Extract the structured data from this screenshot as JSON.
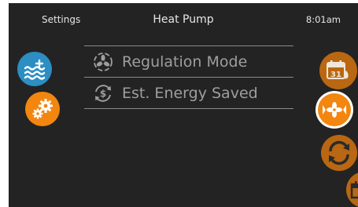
{
  "header": {
    "left_label": "Settings",
    "title": "Heat Pump",
    "time": "8:01am"
  },
  "left_buttons": [
    {
      "icon": "water-heat-icon",
      "color": "#2c8ec3"
    },
    {
      "icon": "gears-icon",
      "color": "#f2860f"
    }
  ],
  "menu": {
    "items": [
      {
        "label": "Regulation Mode",
        "icon": "fan-icon"
      },
      {
        "label": "Est. Energy Saved",
        "icon": "dollar-cycle-icon"
      }
    ]
  },
  "right_buttons": [
    {
      "icon": "calendar-icon",
      "calendar_day": "31",
      "color": "#b96712"
    },
    {
      "icon": "heat-pump-fan-icon",
      "color": "#f2860f",
      "selected": true
    },
    {
      "icon": "cycle-icon",
      "color": "#b96712"
    },
    {
      "icon": "calendar-partial-icon",
      "color": "#b96712"
    }
  ]
}
